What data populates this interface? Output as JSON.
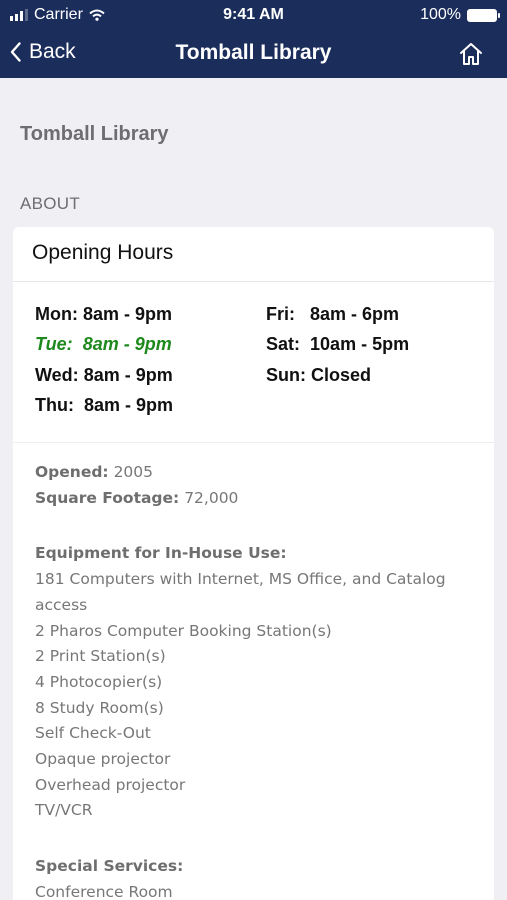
{
  "status_bar": {
    "carrier": "Carrier",
    "time": "9:41 AM",
    "battery": "100%"
  },
  "nav": {
    "back_label": "Back",
    "title": "Tomball Library",
    "home_icon": "home-icon",
    "color": "#1b2d5b"
  },
  "page_title": "Tomball Library",
  "section_label": "ABOUT",
  "opening_hours": {
    "title": "Opening Hours",
    "left": [
      {
        "day": "Mon:",
        "hours": "8am - 9pm",
        "today": false
      },
      {
        "day": "Tue:",
        "hours": "8am - 9pm",
        "today": true
      },
      {
        "day": "Wed:",
        "hours": "8am - 9pm",
        "today": false
      },
      {
        "day": "Thu:",
        "hours": "8am - 9pm",
        "today": false
      }
    ],
    "right": [
      {
        "day": "Fri:",
        "hours": "8am - 6pm"
      },
      {
        "day": "Sat:",
        "hours": "10am - 5pm"
      },
      {
        "day": "Sun:",
        "hours": "Closed"
      }
    ],
    "today_color": "#1e8a1e"
  },
  "details": {
    "opened_label": "Opened:",
    "opened_value": "2005",
    "footage_label": "Square Footage:",
    "footage_value": "72,000",
    "equipment_label": "Equipment for In-House Use:",
    "equipment": [
      "181 Computers with Internet, MS Office, and Catalog access",
      "2 Pharos Computer Booking Station(s)",
      "2 Print Station(s)",
      "4 Photocopier(s)",
      "8 Study Room(s)",
      "Self Check-Out",
      "Opaque projector",
      "Overhead projector",
      "TV/VCR"
    ],
    "services_label": "Special Services:",
    "services": [
      "Conference Room"
    ]
  }
}
